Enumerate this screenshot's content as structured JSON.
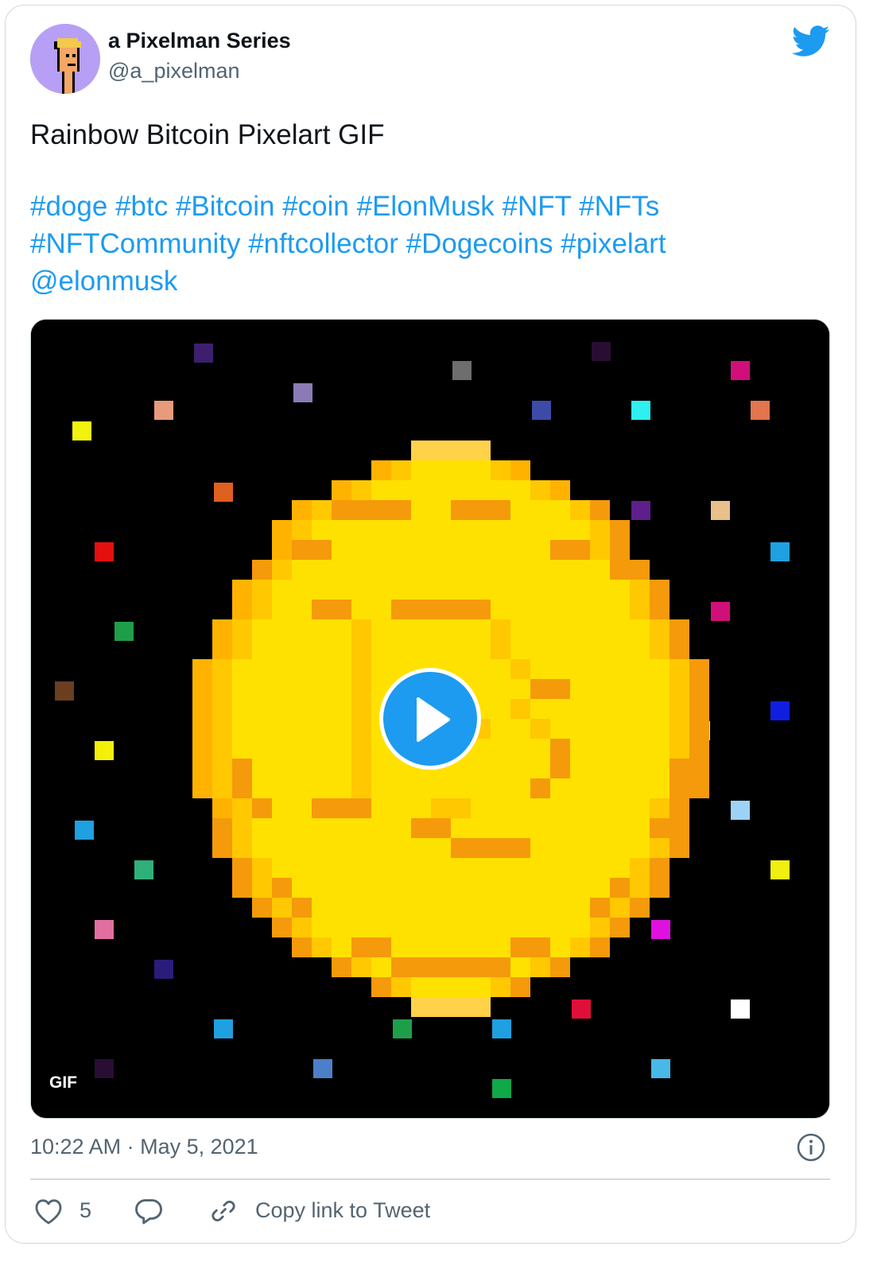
{
  "author": {
    "display_name": "a Pixelman Series",
    "handle": "@a_pixelman",
    "avatar_icon": "pixel-man-avatar-icon",
    "avatar_bg": "#b79ff5"
  },
  "brand_icon": "twitter-bird-icon",
  "tweet": {
    "text": "Rainbow Bitcoin Pixelart GIF",
    "hashtags": [
      "#doge",
      "#btc",
      "#Bitcoin",
      "#coin",
      "#ElonMusk",
      "#NFT",
      "#NFTs",
      "#NFTCommunity",
      "#nftcollector",
      "#Dogecoins",
      "#pixelart"
    ],
    "mention": "@elonmusk"
  },
  "media": {
    "badge": "GIF",
    "play_icon": "play-icon"
  },
  "meta": {
    "timestamp": "10:22 AM · May 5, 2021",
    "info_icon": "info-icon"
  },
  "actions": {
    "like_count": "5",
    "copy_link_label": "Copy link to Tweet"
  },
  "colors": {
    "accent": "#1d9bf0",
    "text_primary": "#0f1419",
    "text_secondary": "#536471",
    "border": "#cfd9de"
  }
}
